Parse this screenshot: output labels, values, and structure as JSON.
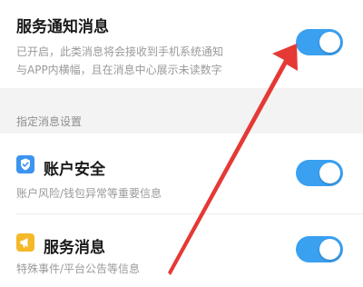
{
  "service_notice": {
    "title": "服务通知消息",
    "desc_line1": "已开启，此类消息将会接收到手机系统通知",
    "desc_line2": "与APP内横幅，且在消息中心展示未读数字",
    "enabled": true
  },
  "section_label": "指定消息设置",
  "items": [
    {
      "title": "账户安全",
      "desc": "账户风险/钱包异常等重要信息",
      "icon": "shield-check-icon",
      "enabled": true
    },
    {
      "title": "服务消息",
      "desc": "特殊事件/平台公告等信息",
      "icon": "megaphone-icon",
      "enabled": true
    }
  ],
  "colors": {
    "toggle_on": "#3aa0f0",
    "arrow": "#e53935",
    "section_bg": "#f3f3f3"
  }
}
